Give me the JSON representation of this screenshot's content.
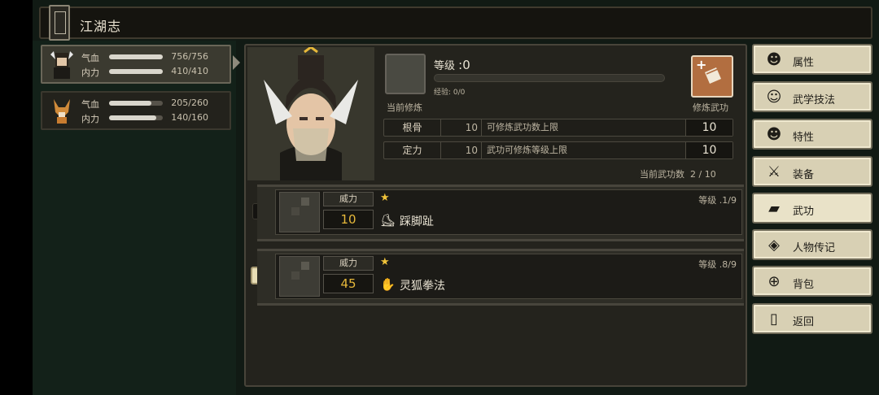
{
  "title": "江湖志",
  "characters": [
    {
      "hp_label": "气血",
      "hp_value": "756/756",
      "hp_fill": 1.0,
      "mp_label": "内力",
      "mp_value": "410/410",
      "mp_fill": 1.0
    },
    {
      "hp_label": "气血",
      "hp_value": "205/260",
      "hp_fill": 0.79,
      "mp_label": "内力",
      "mp_value": "140/160",
      "mp_fill": 0.88
    }
  ],
  "cultivation": {
    "level_label": "等级",
    "level_value": ":0",
    "xp_label": "经验: 0/0",
    "current_label": "当前修炼",
    "train_label": "修炼武功"
  },
  "stats": [
    {
      "name": "根骨",
      "value": "10",
      "desc": "可修炼武功数上限",
      "cap": "10"
    },
    {
      "name": "定力",
      "value": "10",
      "desc": "武功可修炼等级上限",
      "cap": "10"
    }
  ],
  "skill_count_label": "当前武功数",
  "skill_count_value": "2 / 10",
  "skills": [
    {
      "power_label": "威力",
      "power": "10",
      "name": "踩脚趾",
      "level": "等级 .1/9",
      "slot": ""
    },
    {
      "power_label": "威力",
      "power": "45",
      "name": "灵狐拳法",
      "level": "等级 .8/9",
      "slot": "1"
    }
  ],
  "menu": [
    {
      "label": "属性",
      "icon": "person-icon"
    },
    {
      "label": "武学技法",
      "icon": "martial-arts-icon"
    },
    {
      "label": "特性",
      "icon": "traits-icon"
    },
    {
      "label": "装备",
      "icon": "sword-icon"
    },
    {
      "label": "武功",
      "icon": "book-icon"
    },
    {
      "label": "人物传记",
      "icon": "scroll-icon"
    },
    {
      "label": "背包",
      "icon": "bag-icon"
    },
    {
      "label": "返回",
      "icon": "door-icon"
    }
  ],
  "colors": {
    "accent": "#b26e40",
    "power": "#e6b83a",
    "star": "#f0c33a"
  }
}
